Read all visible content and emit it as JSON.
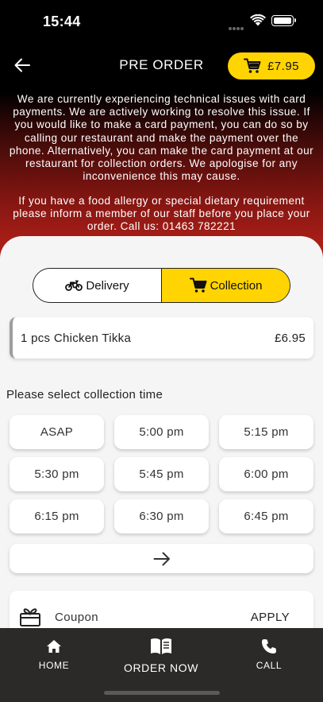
{
  "status_bar": {
    "time": "15:44"
  },
  "header": {
    "title": "PRE ORDER",
    "cart_total": "£7.95"
  },
  "notice": "We are currently experiencing technical issues with card payments. We are actively working to resolve this issue. If you would like to make a card payment, you can do so by calling our restaurant and make the payment over the phone. Alternatively, you can make the card payment at our restaurant for collection orders. We apologise for any inconvenience this may cause.",
  "allergy_notice": "If you have a food allergy or special dietary requirement please inform a member of our staff before you place your order. Call us: 01463 782221",
  "order_type": {
    "options": [
      {
        "label": "Delivery",
        "icon": "motorbike-icon",
        "selected": false
      },
      {
        "label": "Collection",
        "icon": "cart-icon",
        "selected": true
      }
    ]
  },
  "order_items": [
    {
      "name": "1 pcs Chicken Tikka",
      "price": "£6.95"
    }
  ],
  "collection": {
    "label": "Please select collection time",
    "slots": [
      "ASAP",
      "5:00 pm",
      "5:15 pm",
      "5:30 pm",
      "5:45 pm",
      "6:00 pm",
      "6:15 pm",
      "6:30 pm",
      "6:45 pm"
    ]
  },
  "coupon": {
    "label": "Coupon",
    "apply": "APPLY"
  },
  "tabbar": {
    "home": "HOME",
    "order_now": "ORDER NOW",
    "call": "CALL"
  },
  "colors": {
    "accent": "#ffd400",
    "header_gradient_end": "#b01f18",
    "tabbar": "#2b2a29"
  }
}
